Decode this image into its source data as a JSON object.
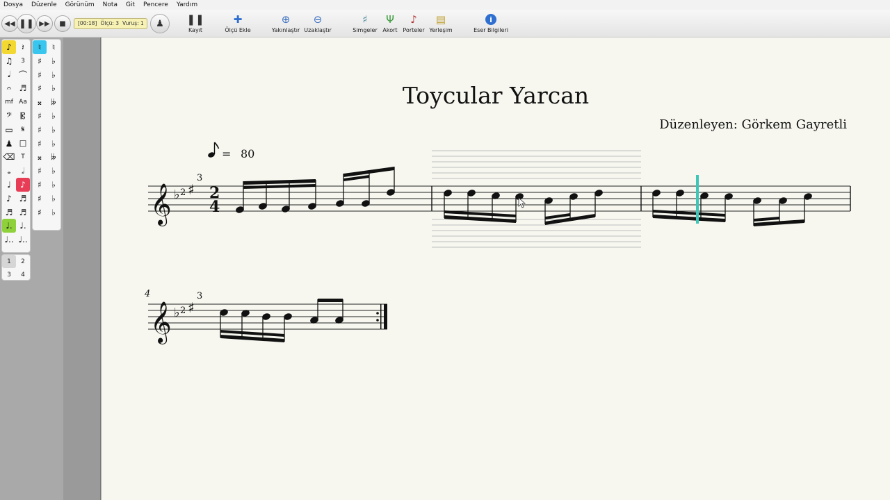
{
  "menu": [
    "Dosya",
    "Düzenle",
    "Görünüm",
    "Nota",
    "Git",
    "Pencere",
    "Yardım"
  ],
  "transport": {
    "rewind": "◀◀",
    "pause": "❚❚",
    "forward": "▶▶",
    "stop": "■",
    "metronome": "♟"
  },
  "status": {
    "time": "[00:18]",
    "measure": "Ölçü: 3",
    "beat": "Vuruş: 1"
  },
  "toolbar": [
    {
      "label": "Kayıt",
      "icon": "❚❚",
      "color": "#333333"
    },
    {
      "label": "Ölçü Ekle",
      "icon": "✚",
      "color": "#2f6fd0"
    },
    {
      "label": "Yakınlaştır",
      "icon": "⊕",
      "color": "#3a6fc0"
    },
    {
      "label": "Uzaklaştır",
      "icon": "⊖",
      "color": "#3a6fc0"
    },
    {
      "label": "Simgeler",
      "icon": "♯",
      "color": "#4a8a9a"
    },
    {
      "label": "Akort",
      "icon": "Ψ",
      "color": "#3d9a3d"
    },
    {
      "label": "Porteler",
      "icon": "♪",
      "color": "#b03030"
    },
    {
      "label": "Yerleşim",
      "icon": "▤",
      "color": "#c0a030"
    },
    {
      "label": "Eser Bilgileri",
      "icon": "i",
      "color": "#2f6fd0"
    }
  ],
  "palette_left": [
    "♪",
    "𝄽",
    "♫",
    "3",
    "𝅘𝅥",
    "⌒",
    "𝄐",
    "♬",
    "mf",
    "Aa",
    "𝄢",
    "𝄡",
    "▭",
    "𝄋",
    "♟",
    "☐",
    "⌫",
    "T",
    "𝅝",
    "𝅗𝅥",
    "♩",
    "♪",
    "♪",
    "♬",
    "♬",
    "♬",
    "♩.",
    "♩.",
    "♩..",
    "♩.."
  ],
  "palette_right": [
    "♮",
    "♮",
    "♯",
    "♭",
    "♯",
    "♭",
    "♯",
    "♭",
    "𝄪",
    "𝄫",
    "♯",
    "♭",
    "♯",
    "♭",
    "♯",
    "♭",
    "𝄪",
    "𝄫",
    "♯",
    "♭",
    "♯",
    "♭",
    "♯",
    "♭",
    "♯",
    "♭"
  ],
  "palette_numbers": [
    "1",
    "2",
    "3",
    "4"
  ],
  "score": {
    "title": "Toycular Yarcan",
    "arranger": "Düzenleyen: Görkem Gayretli",
    "tempo_value": "80",
    "tempo_equals": "=",
    "time_sig_top": "2",
    "time_sig_bottom": "4",
    "accidental_flat_number": "2",
    "accidental_sharp_number": "3",
    "system2_measure_number": "4"
  }
}
